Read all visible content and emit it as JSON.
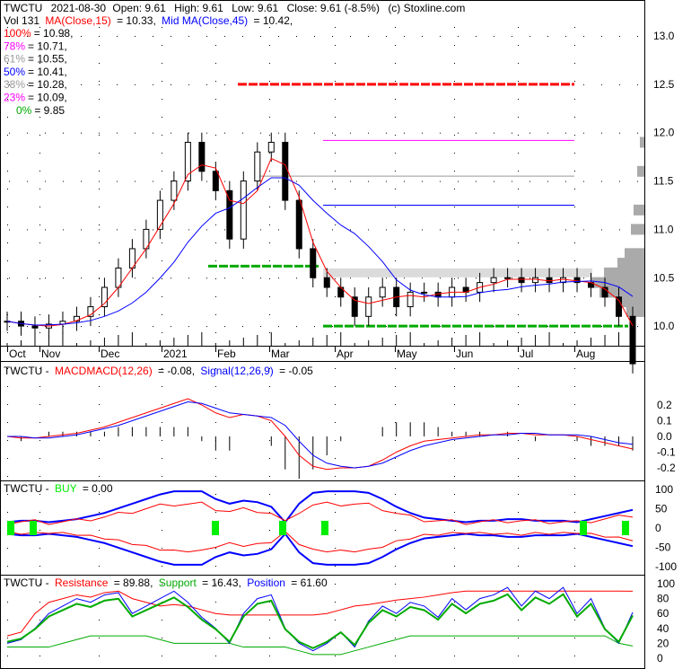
{
  "header": {
    "symbol": "TWCTU",
    "date": "2021-08-30",
    "open": "Open: 9.61",
    "high": "High: 9.61",
    "low": "Low: 9.61",
    "close": "Close: 9.61 (-8.5%)",
    "source": "(c) Stoxline.com"
  },
  "ma_line": {
    "vol": "Vol 131",
    "ma15": "MA(Close,15)",
    "ma15_val": "= 10.33,",
    "ma45": "Mid MA(Close,45)",
    "ma45_val": "= 10.42,"
  },
  "fib": [
    {
      "label": "100%",
      "value": "= 10.98,",
      "level": 10.98,
      "color": "#ff0000"
    },
    {
      "label": "78%",
      "value": "= 10.71,",
      "level": 10.71,
      "color": "#ff00ff"
    },
    {
      "label": "61%",
      "value": "= 10.55,",
      "level": 10.55,
      "color": "#999999"
    },
    {
      "label": "50%",
      "value": "= 10.41,",
      "level": 10.41,
      "color": "#0000ff"
    },
    {
      "label": "38%",
      "value": "= 10.28,",
      "level": 10.28,
      "color": "#999999"
    },
    {
      "label": "23%",
      "value": "= 10.09,",
      "level": 10.09,
      "color": "#ff00ff"
    },
    {
      "label": "0%",
      "value": "= 9.85",
      "level": 9.85,
      "color": "#00aa00"
    }
  ],
  "macd_label": {
    "sym": "TWCTU -",
    "name": "MACDMACD(12,26)",
    "val": "= -0.08,",
    "sig": "Signal(12,26,9)",
    "sigval": "= -0.05"
  },
  "buy_label": {
    "sym": "TWCTU -",
    "name": "BUY",
    "val": "= 0.00"
  },
  "sr_label": {
    "sym": "TWCTU -",
    "res": "Resistance",
    "resval": "= 89.88,",
    "sup": "Support",
    "supval": "= 16.43,",
    "pos": "Position",
    "posval": "= 61.60"
  },
  "chart_data": {
    "type": "line",
    "title": "TWCTU daily price",
    "months": [
      "Oct",
      "Nov",
      "Dec",
      "2021",
      "Feb",
      "Mar",
      "Apr",
      "May",
      "Jun",
      "Jul",
      "Aug"
    ],
    "price_ticks": [
      "13.0",
      "12.5",
      "12.0",
      "11.5",
      "11.0",
      "10.5",
      "10.0"
    ],
    "macd_ticks": [
      "0.2",
      "0.1",
      "0.0",
      "-0.1",
      "-0.2"
    ],
    "buy_ticks": [
      "100",
      "50",
      "0",
      "-50",
      "-100"
    ],
    "sr_ticks": [
      "100",
      "80",
      "60",
      "40",
      "20",
      "0"
    ],
    "closes": [
      10.05,
      10.0,
      9.98,
      10.02,
      10.05,
      10.1,
      10.2,
      10.4,
      10.6,
      10.8,
      11.0,
      11.3,
      11.5,
      11.9,
      11.6,
      11.4,
      10.9,
      11.5,
      11.8,
      11.9,
      11.3,
      10.8,
      10.5,
      10.4,
      10.3,
      10.1,
      10.3,
      10.4,
      10.2,
      10.35,
      10.35,
      10.3,
      10.4,
      10.35,
      10.45,
      10.5,
      10.5,
      10.45,
      10.5,
      10.45,
      10.5,
      10.45,
      10.4,
      10.3,
      10.1,
      9.61
    ],
    "macd": [
      0,
      -0.01,
      -0.01,
      0,
      0.01,
      0.02,
      0.04,
      0.06,
      0.09,
      0.12,
      0.15,
      0.18,
      0.21,
      0.24,
      0.2,
      0.15,
      0.12,
      0.14,
      0.13,
      0.1,
      0.0,
      -0.12,
      -0.19,
      -0.21,
      -0.2,
      -0.2,
      -0.19,
      -0.15,
      -0.1,
      -0.06,
      -0.03,
      -0.02,
      -0.01,
      0,
      0.01,
      0.01,
      0.02,
      0.02,
      0.01,
      0.01,
      0.01,
      0.0,
      -0.02,
      -0.04,
      -0.06,
      -0.08
    ],
    "signal": [
      0,
      0,
      -0.01,
      -0.01,
      0,
      0.01,
      0.03,
      0.05,
      0.07,
      0.1,
      0.13,
      0.16,
      0.19,
      0.22,
      0.21,
      0.18,
      0.15,
      0.14,
      0.13,
      0.12,
      0.07,
      -0.03,
      -0.12,
      -0.17,
      -0.19,
      -0.2,
      -0.19,
      -0.17,
      -0.13,
      -0.09,
      -0.06,
      -0.04,
      -0.02,
      -0.01,
      0,
      0.01,
      0.01,
      0.02,
      0.02,
      0.01,
      0.01,
      0.01,
      0,
      -0.02,
      -0.04,
      -0.05
    ],
    "resistance": [
      30,
      35,
      60,
      75,
      80,
      85,
      82,
      88,
      90,
      80,
      75,
      70,
      72,
      70,
      65,
      60,
      58,
      58,
      58,
      58,
      58,
      58,
      58,
      60,
      65,
      70,
      72,
      75,
      78,
      80,
      82,
      85,
      88,
      90,
      90,
      90,
      90,
      90,
      90,
      90,
      90,
      90,
      90,
      90,
      90,
      89.88
    ],
    "support": [
      15,
      15,
      15,
      15,
      20,
      25,
      30,
      30,
      30,
      30,
      30,
      25,
      20,
      20,
      20,
      20,
      20,
      15,
      15,
      15,
      15,
      10,
      5,
      5,
      5,
      10,
      15,
      20,
      25,
      30,
      30,
      30,
      30,
      30,
      30,
      30,
      30,
      30,
      30,
      30,
      30,
      30,
      30,
      30,
      20,
      16.43
    ],
    "position": [
      20,
      25,
      40,
      60,
      70,
      80,
      75,
      85,
      88,
      60,
      70,
      80,
      90,
      75,
      55,
      40,
      20,
      60,
      80,
      85,
      40,
      20,
      10,
      20,
      35,
      15,
      50,
      70,
      60,
      75,
      70,
      55,
      80,
      65,
      80,
      85,
      95,
      70,
      90,
      80,
      95,
      60,
      80,
      40,
      20,
      61.6
    ]
  }
}
